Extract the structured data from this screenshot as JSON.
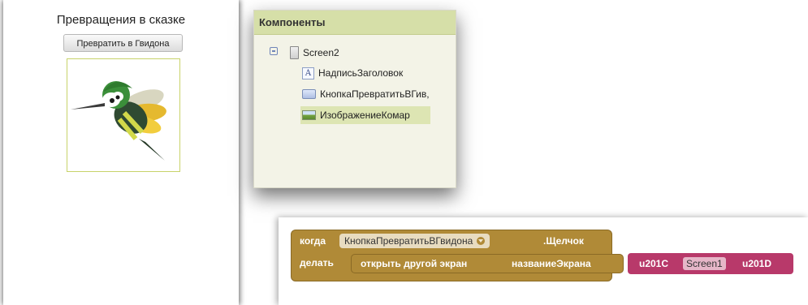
{
  "phone": {
    "title": "Превращения в сказке",
    "button_label": "Превратить в Гвидона"
  },
  "components": {
    "header": "Компоненты",
    "root": "Screen2",
    "items": [
      {
        "label": "НадписьЗаголовок",
        "icon": "label-icon"
      },
      {
        "label": "КнопкаПревратитьВГив,",
        "icon": "button-icon"
      },
      {
        "label": "ИзображениеКомар",
        "icon": "image-icon"
      }
    ]
  },
  "blocks": {
    "when_keyword": "когда",
    "component_dropdown": "КнопкаПревратитьВГвидона",
    "event_name": ".Щелчок",
    "do_keyword": "делать",
    "open_screen": "открыть другой экран",
    "screen_name_param": "названиеЭкрана",
    "quote_open": "u201C",
    "screen_value": "Screen1",
    "quote_close": "u201D"
  },
  "colors": {
    "control_block": "#b08a37",
    "text_block": "#b8396a",
    "components_header": "#d6dfa8",
    "image_border": "#c8d36a"
  }
}
